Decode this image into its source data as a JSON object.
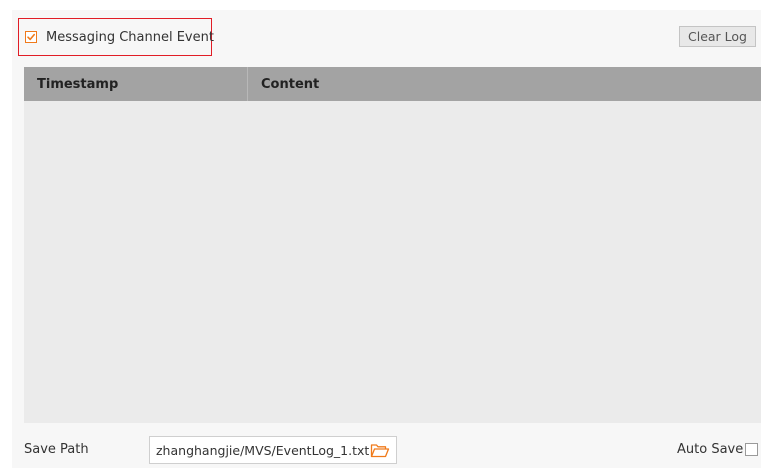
{
  "event_log": {
    "channel_event": {
      "label": "Messaging Channel Event",
      "checked": true,
      "check_color": "#f07a1a",
      "highlight_color": "#e11d26"
    },
    "clear_button_label": "Clear Log",
    "table": {
      "columns": [
        "Timestamp",
        "Content"
      ],
      "rows": []
    }
  },
  "footer": {
    "save_path_label": "Save Path",
    "save_path_value": "zhanghangjie/MVS/EventLog_1.txt",
    "folder_icon": "folder-open-icon",
    "auto_save_label": "Auto Save",
    "auto_save_checked": false
  }
}
